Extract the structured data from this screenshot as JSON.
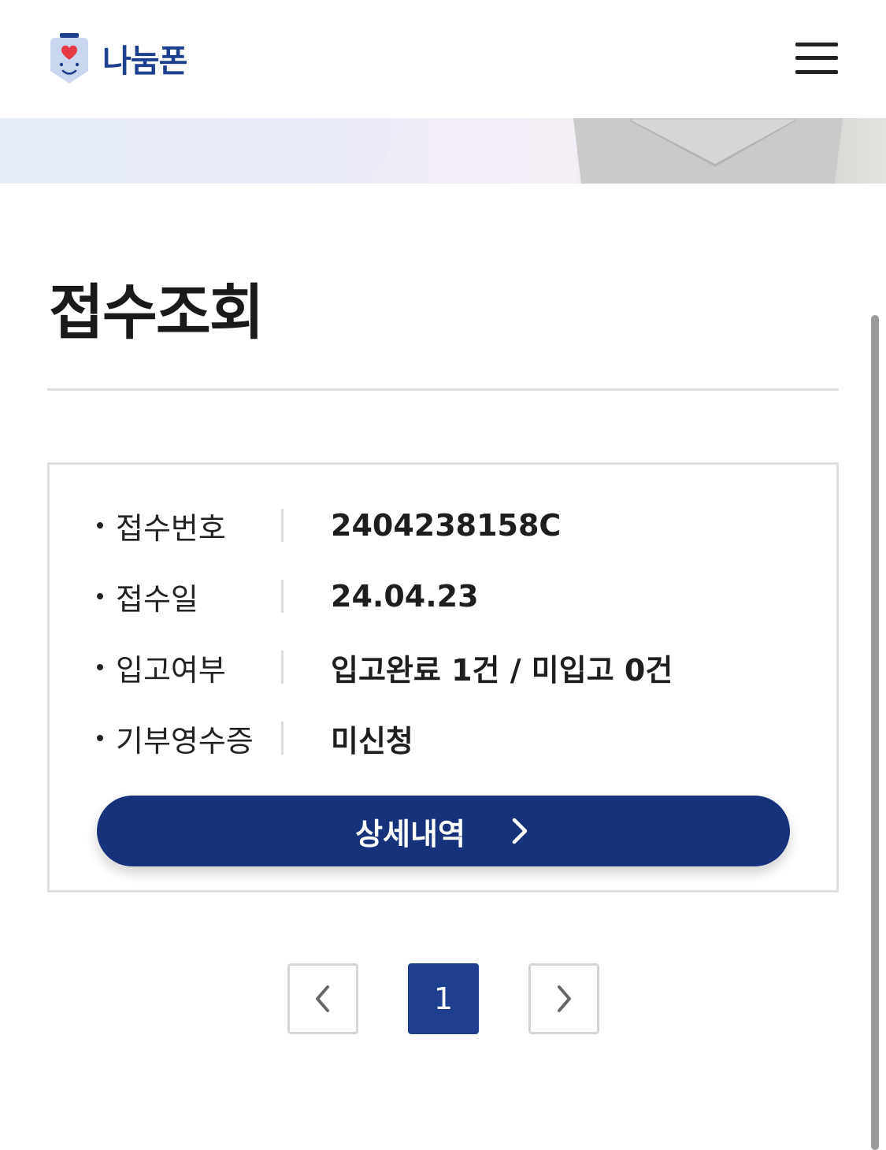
{
  "header": {
    "logo_text": "나눔폰",
    "logo_icon": "smiley-phone-heart-icon",
    "menu_icon": "hamburger-menu-icon",
    "brand_color": "#1f3f8f"
  },
  "page": {
    "title": "접수조회"
  },
  "receipt": {
    "rows": [
      {
        "label": "접수번호",
        "value": "2404238158C"
      },
      {
        "label": "접수일",
        "value": "24.04.23"
      },
      {
        "label": "입고여부",
        "value": "입고완료 1건 / 미입고 0건"
      },
      {
        "label": "기부영수증",
        "value": "미신청"
      }
    ],
    "detail_button_label": "상세내역",
    "button_color": "#17327a"
  },
  "pagination": {
    "current_page": "1",
    "prev_icon": "chevron-left-icon",
    "next_icon": "chevron-right-icon",
    "active_color": "#1e3f8f"
  }
}
